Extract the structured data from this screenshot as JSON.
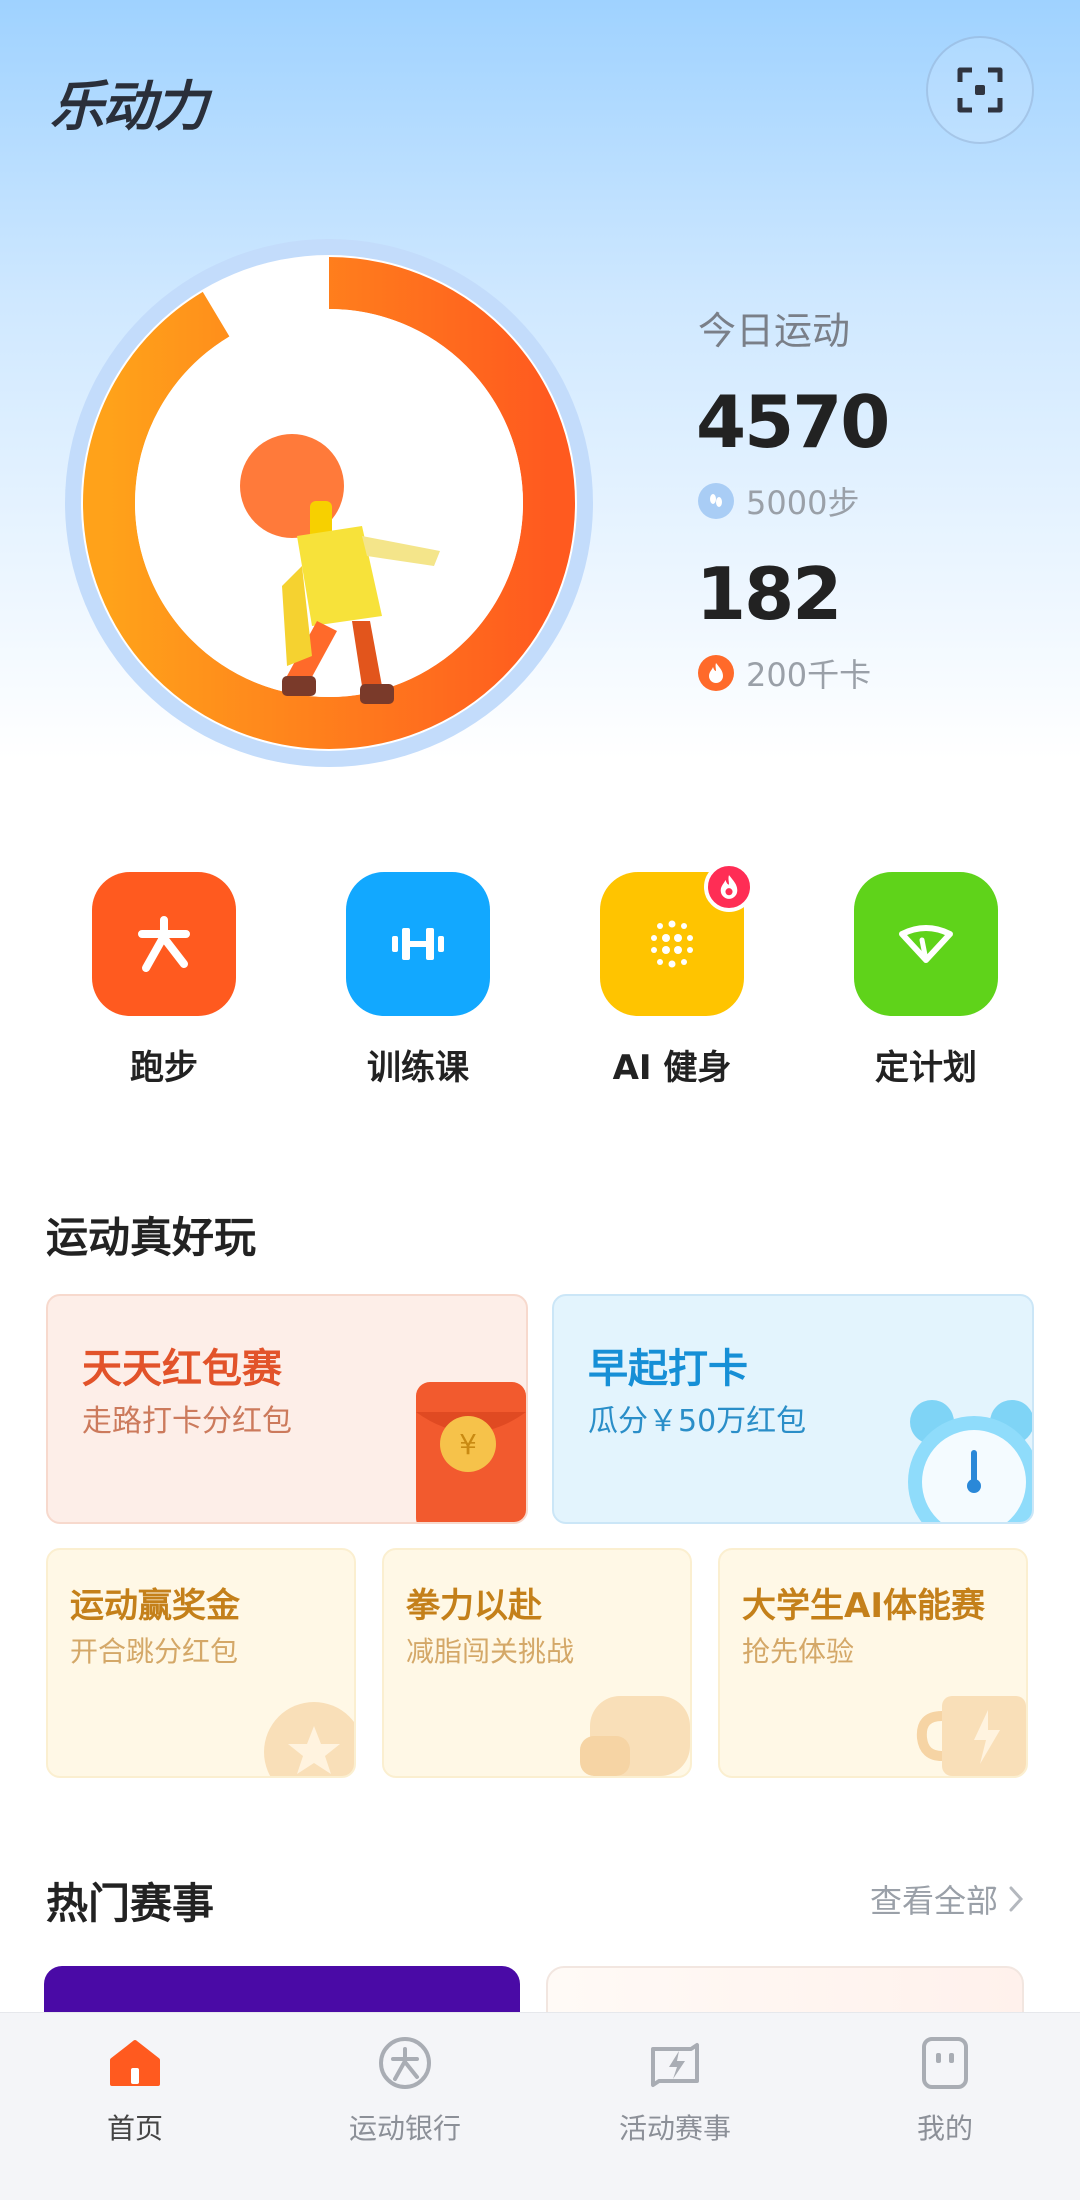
{
  "header": {
    "app_title": "乐动力"
  },
  "today": {
    "label": "今日运动",
    "steps": "4570",
    "steps_goal": "5000步",
    "steps_progress": 0.914,
    "calories": "182",
    "calories_goal": "200千卡"
  },
  "quick_actions": [
    {
      "label": "跑步",
      "color": "#ff5a1f",
      "icon": "running-icon"
    },
    {
      "label": "训练课",
      "color": "#12a8ff",
      "icon": "dumbbell-icon"
    },
    {
      "label": "AI 健身",
      "color": "#ffc400",
      "icon": "ai-dots-icon",
      "badge": "fire-badge"
    },
    {
      "label": "定计划",
      "color": "#5fd31a",
      "icon": "plan-icon"
    }
  ],
  "fun_section": {
    "title": "运动真好玩",
    "big_cards": [
      {
        "title": "天天红包赛",
        "subtitle": "走路打卡分红包"
      },
      {
        "title": "早起打卡",
        "subtitle": "瓜分￥50万红包"
      }
    ],
    "small_cards": [
      {
        "title": "运动赢奖金",
        "subtitle": "开合跳分红包"
      },
      {
        "title": "拳力以赴",
        "subtitle": "减脂闯关挑战"
      },
      {
        "title": "大学生AI体能赛",
        "subtitle": "抢先体验"
      }
    ]
  },
  "hot_events": {
    "title": "热门赛事",
    "view_all": "查看全部"
  },
  "tabbar": [
    {
      "label": "首页",
      "icon": "home-icon",
      "active": true
    },
    {
      "label": "运动银行",
      "icon": "sports-bank-icon",
      "active": false
    },
    {
      "label": "活动赛事",
      "icon": "events-icon",
      "active": false
    },
    {
      "label": "我的",
      "icon": "profile-icon",
      "active": false
    }
  ]
}
